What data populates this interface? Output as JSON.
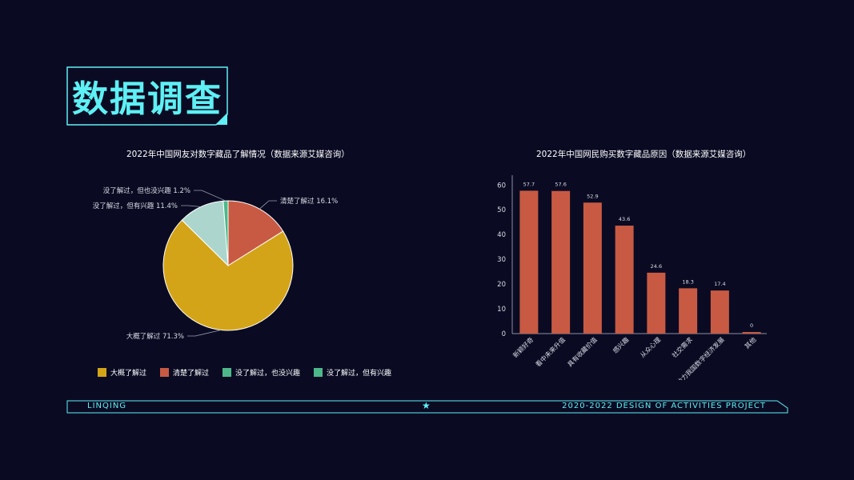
{
  "header": {
    "title": "数据调查"
  },
  "footer": {
    "left": "LINQING",
    "right": "2020-2022 DESIGN OF ACTIVITIES PROJECT",
    "star_icon": "star-icon"
  },
  "theme": {
    "accent": "#5ef0f4",
    "background": "#0a0b23"
  },
  "chart_data": [
    {
      "type": "pie",
      "title": "2022年中国网友对数字藏品了解情况（数据来源艾媒咨询）",
      "slices": [
        {
          "label": "清楚了解过",
          "value": 16.1,
          "display": "清楚了解过  16.1%",
          "color": "#c85a43"
        },
        {
          "label": "大概了解过",
          "value": 71.3,
          "display": "大概了解过  71.3%",
          "color": "#d4a418"
        },
        {
          "label": "没了解过，但有兴趣",
          "value": 11.4,
          "display": "没了解过，但有兴趣 11.4%",
          "color": "#acd6cd"
        },
        {
          "label": "没了解过，但也没兴趣",
          "value": 1.2,
          "display": "没了解过，但也没兴趣 1.2%",
          "color": "#4db88a"
        }
      ],
      "legend": [
        {
          "label": "大概了解过",
          "color": "#d4a418"
        },
        {
          "label": "清楚了解过",
          "color": "#c85a43"
        },
        {
          "label": "没了解过，也没兴趣",
          "color": "#4db88a"
        },
        {
          "label": "没了解过，但有兴趣",
          "color": "#4db88a"
        }
      ],
      "legend_position": "bottom-left"
    },
    {
      "type": "bar",
      "title": "2022年中国网民购买数字藏品原因（数据来源艾媒咨询）",
      "categories": [
        "新颖好奇",
        "看中未来升值",
        "具有收藏价值",
        "感兴趣",
        "从众心理",
        "社交需求",
        "助力我国数字经济发展",
        "其他"
      ],
      "values": [
        57.7,
        57.6,
        52.9,
        43.6,
        24.6,
        18.3,
        17.4,
        0
      ],
      "value_labels": [
        "57.7",
        "57.6",
        "52.9",
        "43.6",
        "24.6",
        "18.3",
        "17.4",
        "0"
      ],
      "yticks": [
        "0",
        "10",
        "20",
        "30",
        "40",
        "50",
        "60"
      ],
      "ylim": [
        0,
        63
      ],
      "color": "#c85a43",
      "grid": false
    }
  ]
}
